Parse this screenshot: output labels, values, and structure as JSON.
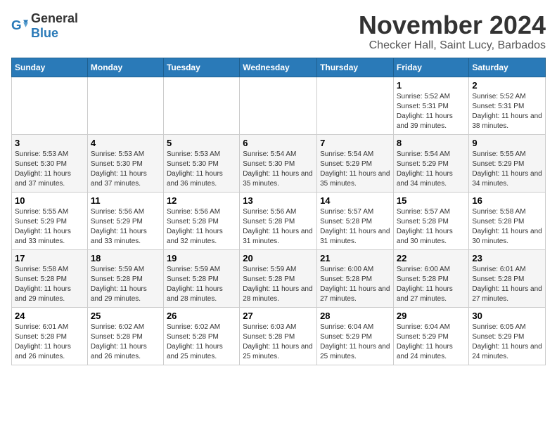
{
  "logo": {
    "general": "General",
    "blue": "Blue"
  },
  "header": {
    "month": "November 2024",
    "location": "Checker Hall, Saint Lucy, Barbados"
  },
  "weekdays": [
    "Sunday",
    "Monday",
    "Tuesday",
    "Wednesday",
    "Thursday",
    "Friday",
    "Saturday"
  ],
  "weeks": [
    [
      {
        "day": "",
        "info": ""
      },
      {
        "day": "",
        "info": ""
      },
      {
        "day": "",
        "info": ""
      },
      {
        "day": "",
        "info": ""
      },
      {
        "day": "",
        "info": ""
      },
      {
        "day": "1",
        "info": "Sunrise: 5:52 AM\nSunset: 5:31 PM\nDaylight: 11 hours and 39 minutes."
      },
      {
        "day": "2",
        "info": "Sunrise: 5:52 AM\nSunset: 5:31 PM\nDaylight: 11 hours and 38 minutes."
      }
    ],
    [
      {
        "day": "3",
        "info": "Sunrise: 5:53 AM\nSunset: 5:30 PM\nDaylight: 11 hours and 37 minutes."
      },
      {
        "day": "4",
        "info": "Sunrise: 5:53 AM\nSunset: 5:30 PM\nDaylight: 11 hours and 37 minutes."
      },
      {
        "day": "5",
        "info": "Sunrise: 5:53 AM\nSunset: 5:30 PM\nDaylight: 11 hours and 36 minutes."
      },
      {
        "day": "6",
        "info": "Sunrise: 5:54 AM\nSunset: 5:30 PM\nDaylight: 11 hours and 35 minutes."
      },
      {
        "day": "7",
        "info": "Sunrise: 5:54 AM\nSunset: 5:29 PM\nDaylight: 11 hours and 35 minutes."
      },
      {
        "day": "8",
        "info": "Sunrise: 5:54 AM\nSunset: 5:29 PM\nDaylight: 11 hours and 34 minutes."
      },
      {
        "day": "9",
        "info": "Sunrise: 5:55 AM\nSunset: 5:29 PM\nDaylight: 11 hours and 34 minutes."
      }
    ],
    [
      {
        "day": "10",
        "info": "Sunrise: 5:55 AM\nSunset: 5:29 PM\nDaylight: 11 hours and 33 minutes."
      },
      {
        "day": "11",
        "info": "Sunrise: 5:56 AM\nSunset: 5:29 PM\nDaylight: 11 hours and 33 minutes."
      },
      {
        "day": "12",
        "info": "Sunrise: 5:56 AM\nSunset: 5:28 PM\nDaylight: 11 hours and 32 minutes."
      },
      {
        "day": "13",
        "info": "Sunrise: 5:56 AM\nSunset: 5:28 PM\nDaylight: 11 hours and 31 minutes."
      },
      {
        "day": "14",
        "info": "Sunrise: 5:57 AM\nSunset: 5:28 PM\nDaylight: 11 hours and 31 minutes."
      },
      {
        "day": "15",
        "info": "Sunrise: 5:57 AM\nSunset: 5:28 PM\nDaylight: 11 hours and 30 minutes."
      },
      {
        "day": "16",
        "info": "Sunrise: 5:58 AM\nSunset: 5:28 PM\nDaylight: 11 hours and 30 minutes."
      }
    ],
    [
      {
        "day": "17",
        "info": "Sunrise: 5:58 AM\nSunset: 5:28 PM\nDaylight: 11 hours and 29 minutes."
      },
      {
        "day": "18",
        "info": "Sunrise: 5:59 AM\nSunset: 5:28 PM\nDaylight: 11 hours and 29 minutes."
      },
      {
        "day": "19",
        "info": "Sunrise: 5:59 AM\nSunset: 5:28 PM\nDaylight: 11 hours and 28 minutes."
      },
      {
        "day": "20",
        "info": "Sunrise: 5:59 AM\nSunset: 5:28 PM\nDaylight: 11 hours and 28 minutes."
      },
      {
        "day": "21",
        "info": "Sunrise: 6:00 AM\nSunset: 5:28 PM\nDaylight: 11 hours and 27 minutes."
      },
      {
        "day": "22",
        "info": "Sunrise: 6:00 AM\nSunset: 5:28 PM\nDaylight: 11 hours and 27 minutes."
      },
      {
        "day": "23",
        "info": "Sunrise: 6:01 AM\nSunset: 5:28 PM\nDaylight: 11 hours and 27 minutes."
      }
    ],
    [
      {
        "day": "24",
        "info": "Sunrise: 6:01 AM\nSunset: 5:28 PM\nDaylight: 11 hours and 26 minutes."
      },
      {
        "day": "25",
        "info": "Sunrise: 6:02 AM\nSunset: 5:28 PM\nDaylight: 11 hours and 26 minutes."
      },
      {
        "day": "26",
        "info": "Sunrise: 6:02 AM\nSunset: 5:28 PM\nDaylight: 11 hours and 25 minutes."
      },
      {
        "day": "27",
        "info": "Sunrise: 6:03 AM\nSunset: 5:28 PM\nDaylight: 11 hours and 25 minutes."
      },
      {
        "day": "28",
        "info": "Sunrise: 6:04 AM\nSunset: 5:29 PM\nDaylight: 11 hours and 25 minutes."
      },
      {
        "day": "29",
        "info": "Sunrise: 6:04 AM\nSunset: 5:29 PM\nDaylight: 11 hours and 24 minutes."
      },
      {
        "day": "30",
        "info": "Sunrise: 6:05 AM\nSunset: 5:29 PM\nDaylight: 11 hours and 24 minutes."
      }
    ]
  ]
}
